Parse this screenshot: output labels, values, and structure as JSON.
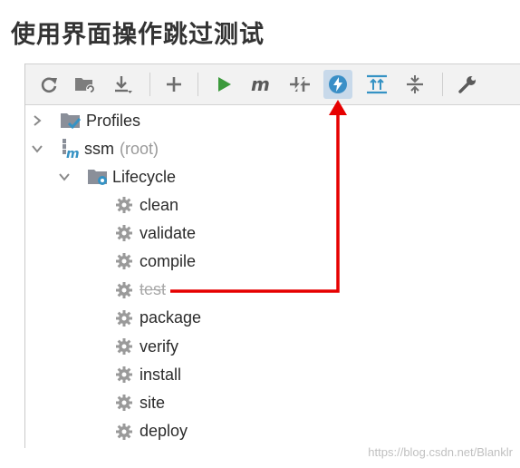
{
  "heading": "使用界面操作跳过测试",
  "toolbar": {
    "buttons": [
      {
        "name": "reimport-icon"
      },
      {
        "name": "generate-sources-icon"
      },
      {
        "name": "download-icon"
      },
      {
        "name": "add-icon"
      },
      {
        "name": "run-icon"
      },
      {
        "name": "execute-goal-icon"
      },
      {
        "name": "toggle-offline-icon"
      },
      {
        "name": "skip-tests-icon"
      },
      {
        "name": "show-dependencies-icon"
      },
      {
        "name": "collapse-all-icon"
      },
      {
        "name": "settings-wrench-icon"
      }
    ],
    "active_button": "skip-tests-icon"
  },
  "tree": {
    "profiles_label": "Profiles",
    "project_label": "ssm",
    "project_suffix": "(root)",
    "lifecycle_label": "Lifecycle",
    "phases": [
      "clean",
      "validate",
      "compile",
      "test",
      "package",
      "verify",
      "install",
      "site",
      "deploy"
    ],
    "skipped_phase": "test"
  },
  "watermark": "https://blog.csdn.net/Blanklr",
  "colors": {
    "accent_arrow": "#e60000",
    "run_green": "#3c9a3c",
    "folder_gray": "#8a8f99",
    "blue_icon": "#3592c4",
    "lightning_bg": "#3a8fc7"
  }
}
